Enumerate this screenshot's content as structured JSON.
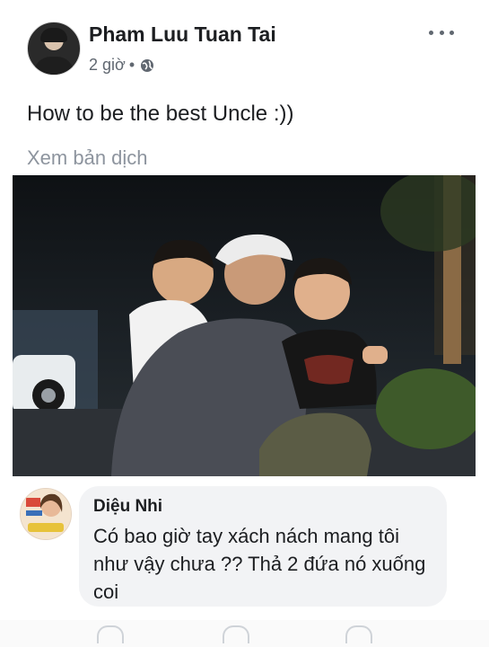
{
  "post": {
    "author": "Pham Luu Tuan Tai",
    "time": "2 giờ",
    "separator": "•",
    "privacy_icon": "globe-icon",
    "more_icon": "more-horizontal-icon",
    "text": "How to be the best Uncle :))",
    "translate_label": "Xem bản dịch"
  },
  "comment": {
    "author": "Diệu Nhi",
    "text": "Có bao giờ tay xách nách mang tôi như vậy chưa ?? Thả 2 đứa nó xuống coi"
  },
  "colors": {
    "text_primary": "#1c1e21",
    "text_secondary": "#606770",
    "link_muted": "#8d949e",
    "bubble_bg": "#f2f3f5"
  }
}
